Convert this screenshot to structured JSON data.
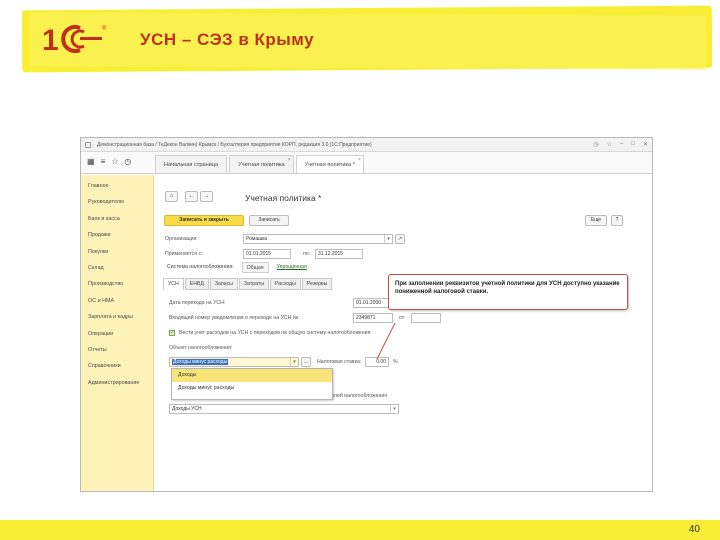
{
  "slide": {
    "title": "УСН – СЭЗ в Крыму",
    "page_number": "40",
    "brand_color": "#c0301f",
    "accent_color": "#f7ee35"
  },
  "window": {
    "title": "Демонстрационная база / ТеДекон Валкин) Крымск / Бухгалтерия предприятия КОРП, редакция 3.0 (1С:Предприятие)",
    "tabs": [
      {
        "label": "Начальная страница",
        "closable": false
      },
      {
        "label": "Учетная политика",
        "closable": true
      },
      {
        "label": "Учетная политика *",
        "closable": true
      }
    ]
  },
  "sidebar": {
    "items": [
      "Главное",
      "Руководителю",
      "Банк и касса",
      "Продажи",
      "Покупки",
      "Склад",
      "Производство",
      "ОС и НМА",
      "Зарплата и кадры",
      "Операции",
      "Отчеты",
      "Справочники",
      "Администрирование"
    ]
  },
  "form": {
    "title": "Учетная политика *",
    "save_close": "Записать и закрыть",
    "save": "Записать",
    "more": "Еще",
    "help": "?",
    "org_label": "Организация:",
    "org_value": "Ромашка",
    "period_label": "Применяется с:",
    "period_from": "01.01.2015",
    "period_to_label": "по:",
    "period_to": "31.12.2015",
    "tax_system_label": "Система налогообложения:",
    "tax_system_options": [
      "Общая",
      "Упрощенная"
    ],
    "subtabs": [
      "УСН",
      "ЕНВД",
      "Запасы",
      "Затраты",
      "Расходы",
      "Резервы"
    ],
    "transition_date_label": "Дата перехода на УСН:",
    "transition_date": "01.01.2000",
    "notice_number_label": "Входящий номер уведомления о переходе на УСН №:",
    "notice_number": "2349871",
    "notice_date_label": "от:",
    "checkbox_label": "Вести учет расходов на УСН с переходом на общую систему налогообложения",
    "object_label": "Объект налогообложения:",
    "object_value": "Доходы минус расходы",
    "rate_label": "Налоговая ставка:",
    "rate_value": "0.00",
    "percent": "%",
    "object_options": [
      "Доходы",
      "Доходы минус расходы"
    ],
    "purpose_label": "для целей налогообложения",
    "bottom_value": "Доходы УСН"
  },
  "callout": {
    "text": "При заполнении реквизитов учетной политики для УСН доступно указание пониженной налоговой ставки."
  }
}
